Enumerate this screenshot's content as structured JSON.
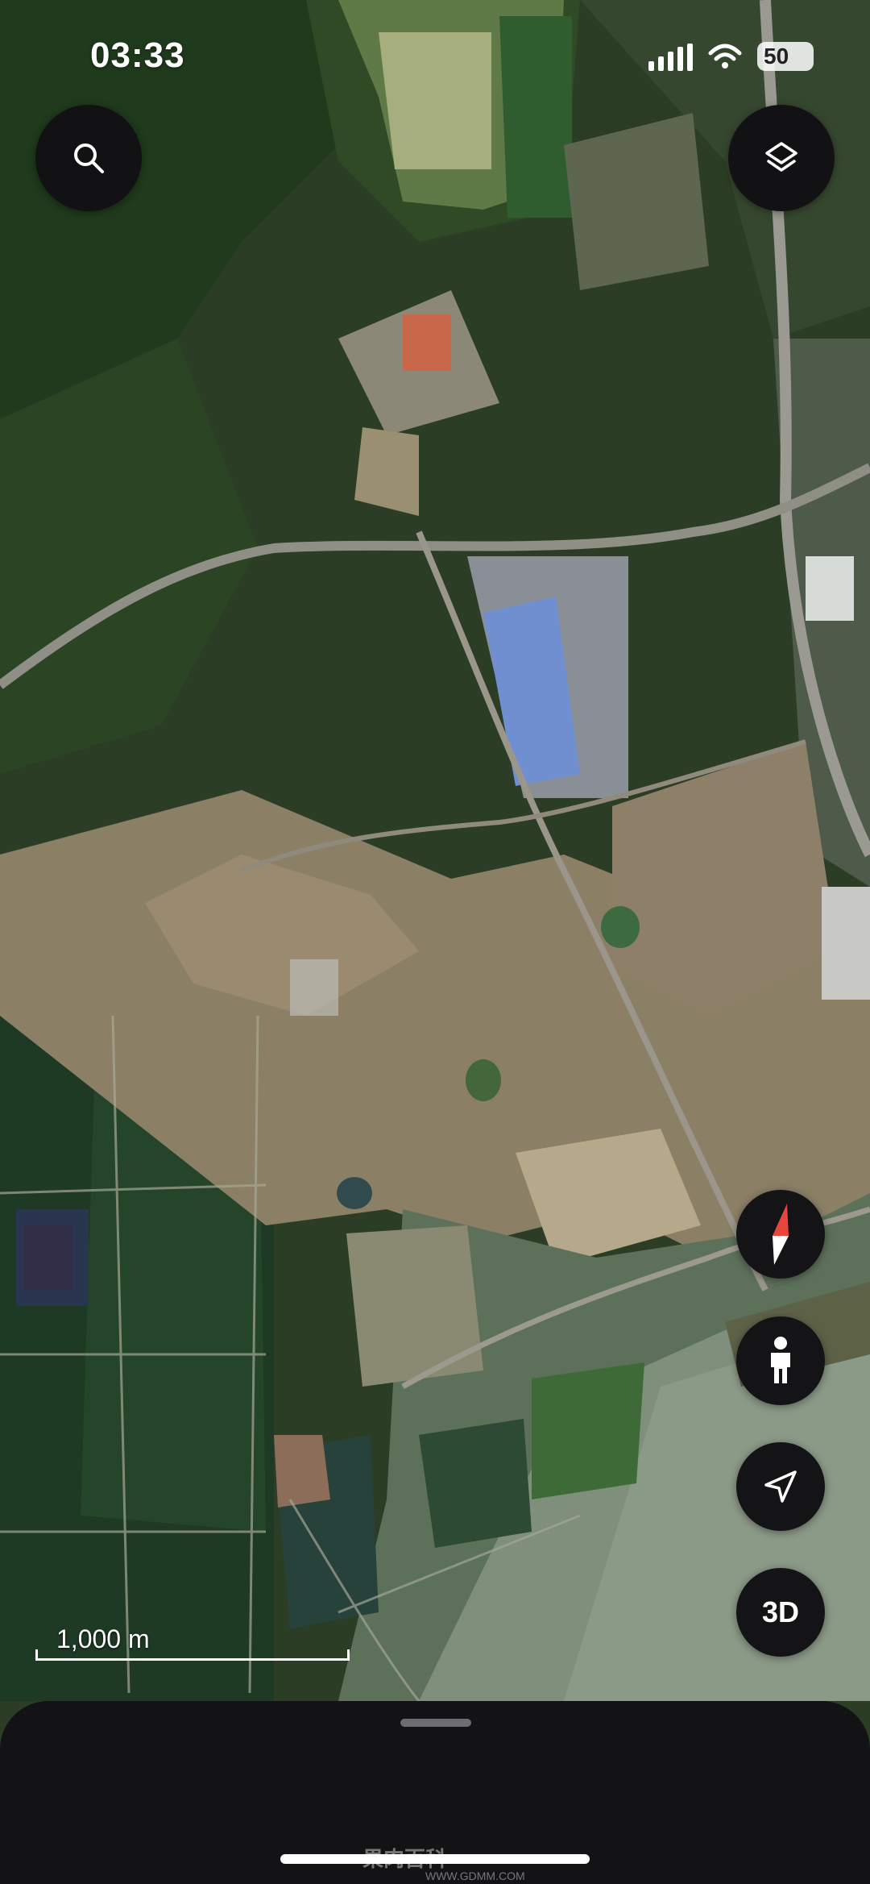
{
  "status_bar": {
    "time": "03:33",
    "battery": "50",
    "signal_icon": "signal-bars-icon",
    "wifi_icon": "wifi-icon"
  },
  "controls": {
    "search_icon": "search-icon",
    "layers_icon": "layers-icon",
    "compass_icon": "compass-icon",
    "street_view_icon": "pegman-icon",
    "locate_icon": "navigation-arrow-icon",
    "view_3d_label": "3D"
  },
  "map": {
    "type": "satellite",
    "scale_label": "1,000 m"
  },
  "bottom_sheet": {
    "handle_icon": "drag-handle-icon"
  },
  "watermark": {
    "text": "果肉百科",
    "url": "WWW.GDMM.COM"
  }
}
